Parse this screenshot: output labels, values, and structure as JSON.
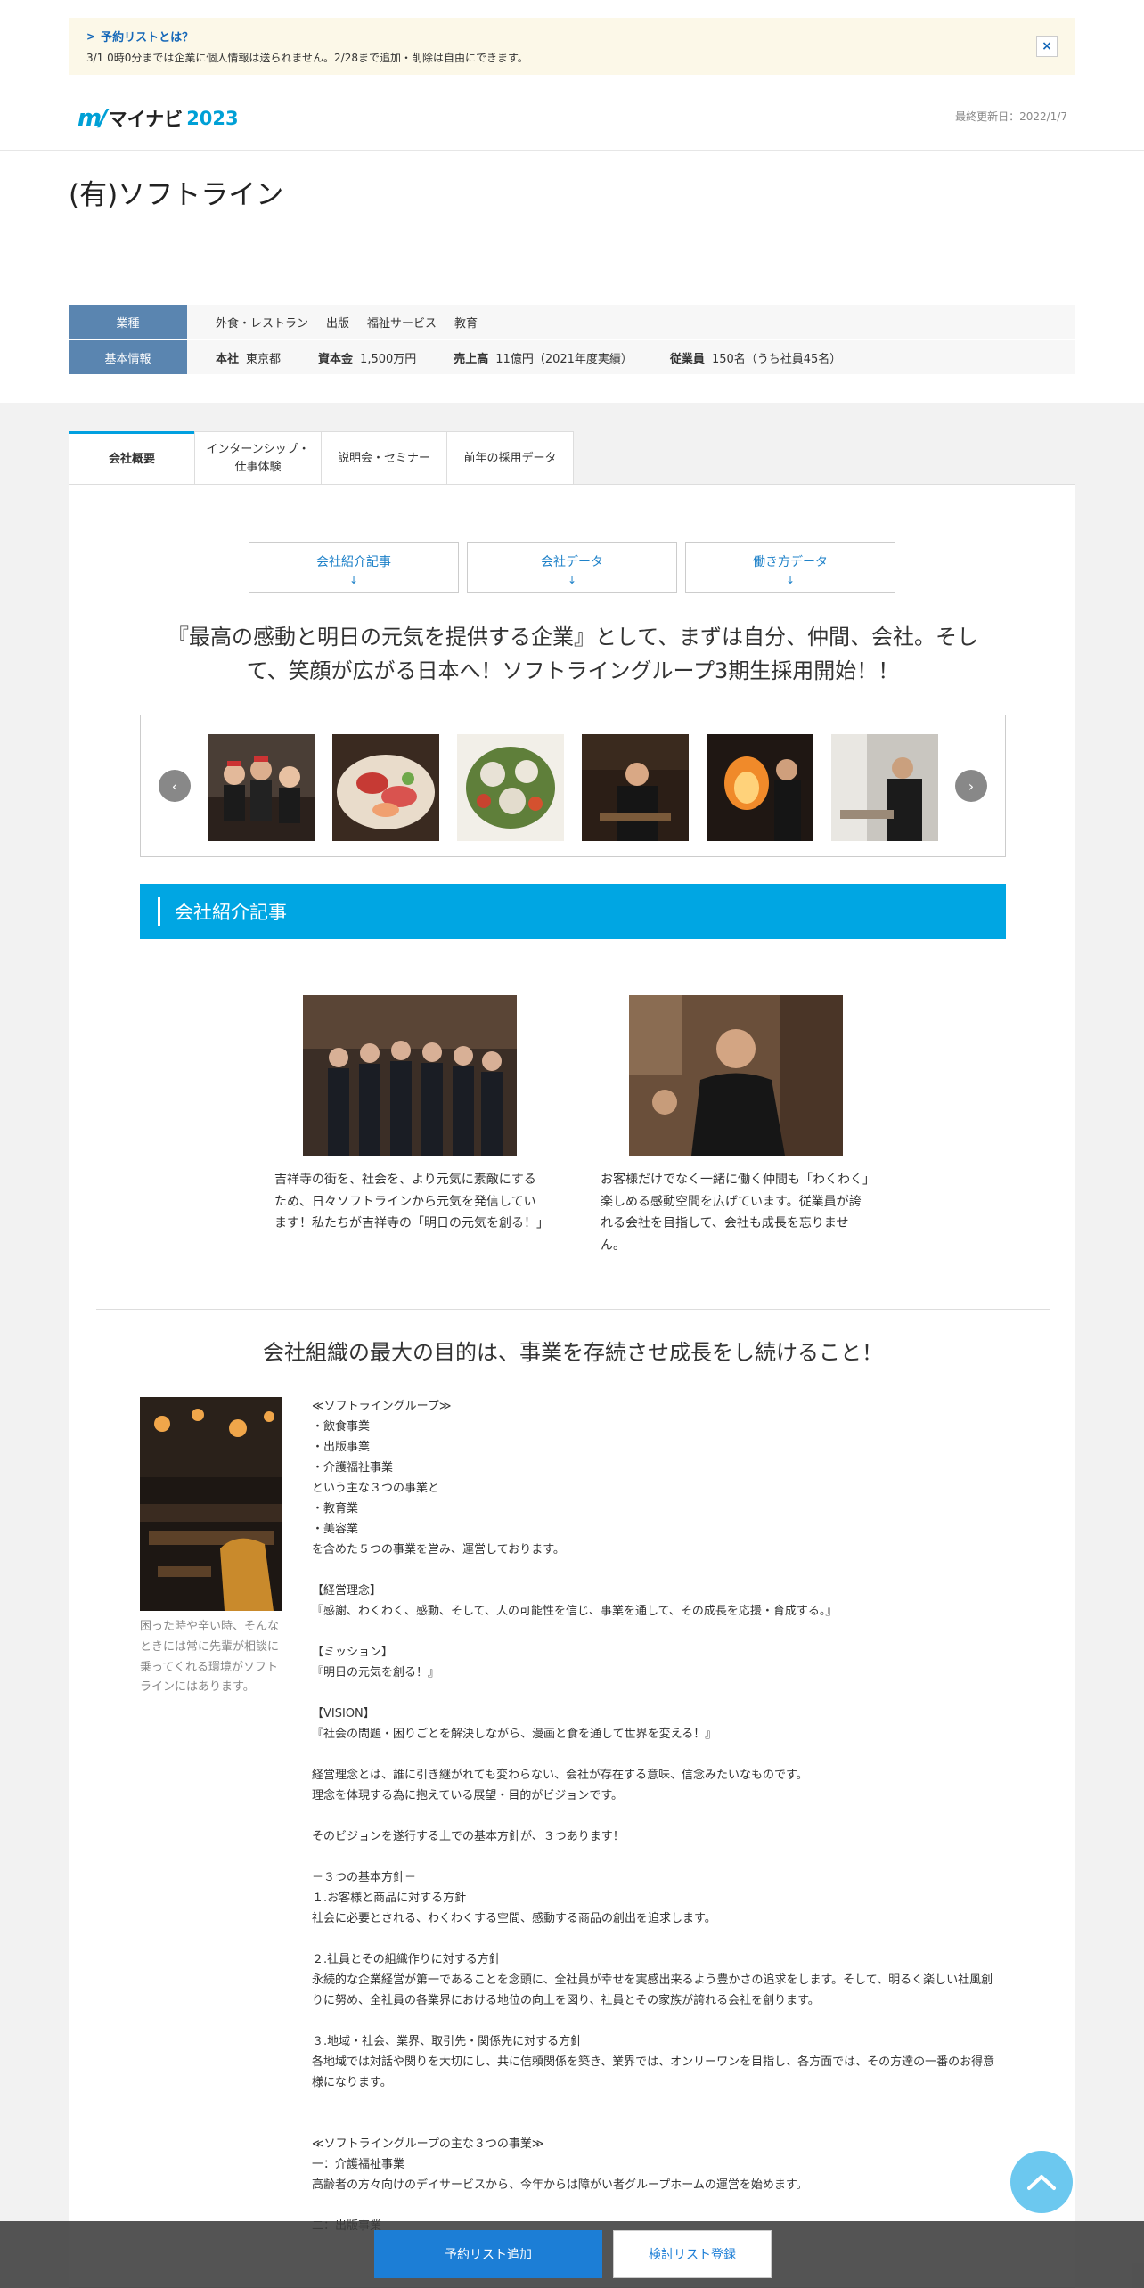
{
  "notice": {
    "title": "予約リストとは？",
    "body": "3/1 0時0分までは企業に個人情報は送られません。2/28まで追加・削除は自由にできます。",
    "close": "×"
  },
  "header": {
    "logo_mark": "m/",
    "logo_text": "マイナビ",
    "logo_year": "2023",
    "updated": "最終更新日：2022/1/7"
  },
  "company": {
    "name": "(有)ソフトライン"
  },
  "info": {
    "industry_label": "業種",
    "industries": [
      "外食・レストラン",
      "出版",
      "福祉サービス",
      "教育"
    ],
    "basic_label": "基本情報",
    "hq_key": "本社",
    "hq_val": "東京都",
    "capital_key": "資本金",
    "capital_val": "1,500万円",
    "sales_key": "売上高",
    "sales_val": "11億円（2021年度実績）",
    "employees_key": "従業員",
    "employees_val": "150名（うち社員45名）"
  },
  "tabs": [
    {
      "label": "会社概要"
    },
    {
      "label": "インターンシップ・\n仕事体験"
    },
    {
      "label": "説明会・セミナー"
    },
    {
      "label": "前年の採用データ"
    }
  ],
  "jumps": [
    {
      "label": "会社紹介記事",
      "arrow": "↓"
    },
    {
      "label": "会社データ",
      "arrow": "↓"
    },
    {
      "label": "働き方データ",
      "arrow": "↓"
    }
  ],
  "headline": "『最高の感動と明日の元気を提供する企業』として、まずは自分、仲間、会社。そして、笑顔が広がる日本へ！ソフトライングループ3期生採用開始！！",
  "carousel": {
    "prev": "‹",
    "next": "›"
  },
  "section": {
    "title": "会社紹介記事"
  },
  "articles": [
    {
      "text": "吉祥寺の街を、社会を、より元気に素敵にするため、日々ソフトラインから元気を発信しています！私たちが吉祥寺の「明日の元気を創る！」"
    },
    {
      "text": "お客様だけでなく一緒に働く仲間も「わくわく」楽しめる感動空間を広げています。従業員が誇れる会社を目指して、会社も成長を忘りません。"
    }
  ],
  "sub_head": "会社組織の最大の目的は、事業を存続させ成長をし続けること！",
  "side_caption": "困った時や辛い時、そんなときには常に先輩が相談に乗ってくれる環境がソフトラインにはあります。",
  "body_text": "≪ソフトライングループ≫\n・飲食事業\n・出版事業\n・介護福祉事業\nという主な３つの事業と\n・教育業\n・美容業\nを含めた５つの事業を営み、運営しております。\n\n【経営理念】\n『感謝、わくわく、感動、そして、人の可能性を信じ、事業を通して、その成長を応援・育成する。』\n\n【ミッション】\n『明日の元気を創る！』\n\n【VISION】\n『社会の問題・困りごとを解決しながら、漫画と食を通して世界を変える！』\n\n経営理念とは、誰に引き継がれても変わらない、会社が存在する意味、信念みたいなものです。\n理念を体現する為に抱えている展望・目的がビジョンです。\n\nそのビジョンを遂行する上での基本方針が、３つあります！\n\n－３つの基本方針－\n１.お客様と商品に対する方針\n社会に必要とされる、わくわくする空間、感動する商品の創出を追求します。\n\n２.社員とその組織作りに対する方針\n永続的な企業経営が第一であることを念頭に、全社員が幸せを実感出来るよう豊かさの追求をします。そして、明るく楽しい社風創りに努め、全社員の各業界における地位の向上を図り、社員とその家族が誇れる会社を創ります。\n\n３.地域・社会、業界、取引先・関係先に対する方針\n各地域では対話や関りを大切にし、共に信頼関係を築き、業界では、オンリーワンを目指し、各方面では、その方達の一番のお得意様になります。\n\n\n≪ソフトライングループの主な３つの事業≫\n一：介護福祉事業\n高齢者の方々向けのデイサービスから、今年からは障がい者グループホームの運営を始めます。\n\n二：出版事業",
  "footer": {
    "reserve": "予約リスト追加",
    "consider": "検討リスト登録"
  }
}
